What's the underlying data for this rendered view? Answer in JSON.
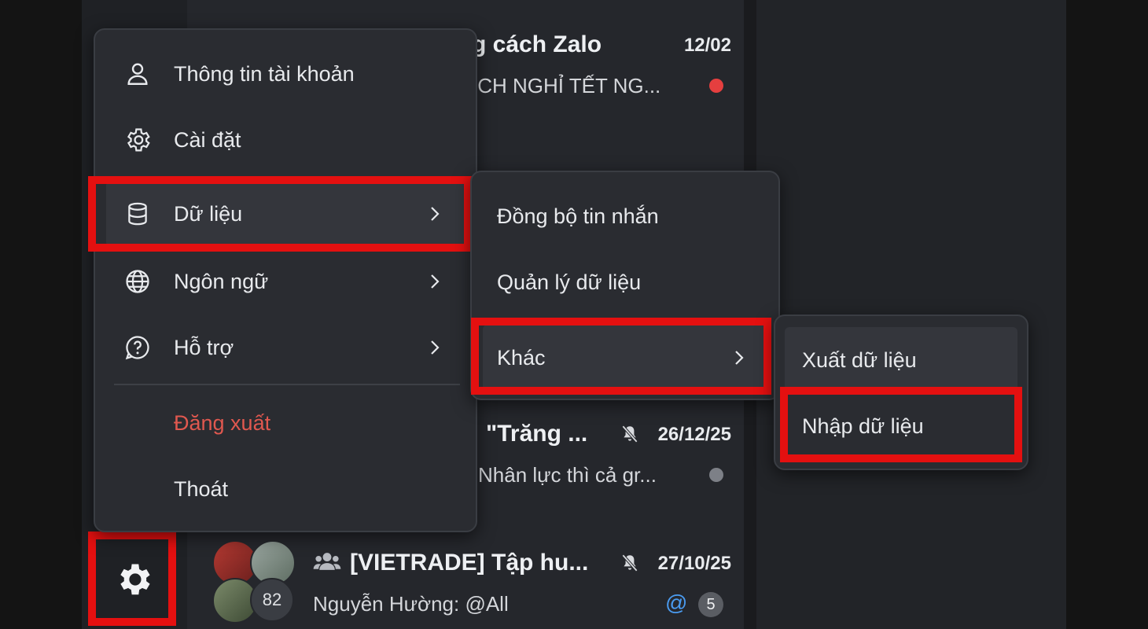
{
  "colors": {
    "highlight": "#e41010",
    "danger": "#e0584f",
    "unread_dot": "#e53f3f",
    "muted_dot": "#7d8087"
  },
  "conversations": [
    {
      "title": "g cách Zalo",
      "date": "12/02",
      "preview": "ỊCH NGHỈ TẾT NG...",
      "dot": "red"
    },
    {
      "title": "\"Trăng ...",
      "date": "26/12/25",
      "preview": "Nhân lực thì cả gr...",
      "dot": "grey",
      "muted": true
    },
    {
      "title": "[VIETRADE] Tập hu...",
      "date": "27/10/25",
      "preview": "Nguyễn Hường: @All",
      "member_count": "82",
      "mention": "@",
      "badge": "5",
      "muted": true,
      "group": true
    }
  ],
  "main_menu": {
    "items": [
      {
        "label": "Thông tin tài khoản",
        "icon": "user-icon"
      },
      {
        "label": "Cài đặt",
        "icon": "gear-icon"
      },
      {
        "label": "Dữ liệu",
        "icon": "database-icon",
        "submenu": true,
        "active": true
      },
      {
        "label": "Ngôn ngữ",
        "icon": "globe-icon",
        "submenu": true
      },
      {
        "label": "Hỗ trợ",
        "icon": "help-icon",
        "submenu": true
      },
      {
        "label": "Đăng xuất",
        "danger": true
      },
      {
        "label": "Thoát"
      }
    ]
  },
  "data_submenu": {
    "items": [
      {
        "label": "Đồng bộ tin nhắn"
      },
      {
        "label": "Quản lý dữ liệu"
      },
      {
        "label": "Khác",
        "submenu": true,
        "active": true
      }
    ]
  },
  "other_submenu": {
    "items": [
      {
        "label": "Xuất dữ liệu"
      },
      {
        "label": "Nhập dữ liệu",
        "highlighted": true
      }
    ]
  },
  "settings_button": {
    "icon": "gear-icon"
  }
}
